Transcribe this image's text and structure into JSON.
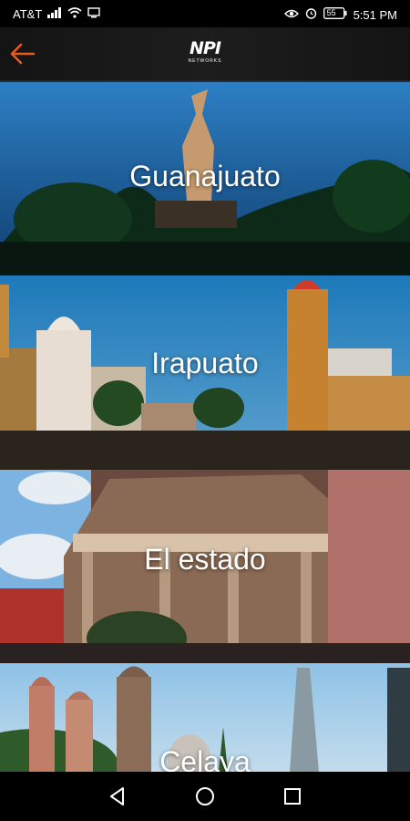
{
  "status_bar": {
    "carrier": "AT&T",
    "battery": "55",
    "time": "5:51 PM"
  },
  "app_bar": {
    "logo_mark": "NPI",
    "logo_sub": "NETWORKS",
    "accent_color": "#e65a1e"
  },
  "cities": [
    {
      "name": "Guanajuato"
    },
    {
      "name": "Irapuato"
    },
    {
      "name": "El estado"
    },
    {
      "name": "Celaya"
    }
  ]
}
